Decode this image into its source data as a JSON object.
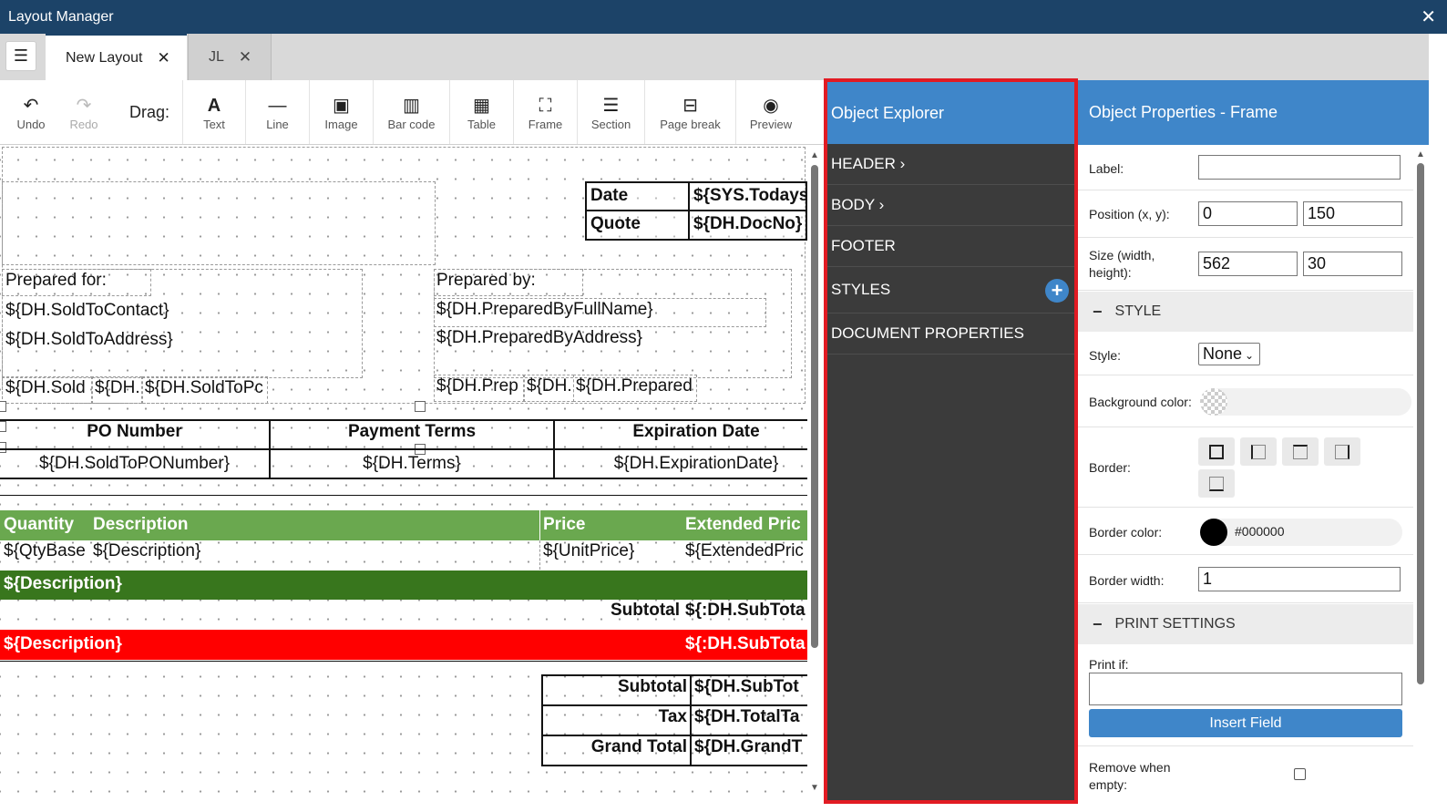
{
  "window": {
    "title": "Layout Manager",
    "close_glyph": "✕"
  },
  "tabs": [
    {
      "label": "New Layout",
      "close_glyph": "✕"
    },
    {
      "label": "JL",
      "close_glyph": "✕"
    }
  ],
  "menu_glyph": "☰",
  "toolbar": {
    "drag_label": "Drag:",
    "items": [
      {
        "label": "Undo",
        "icon": "undo-icon",
        "glyph": "↶"
      },
      {
        "label": "Redo",
        "icon": "redo-icon",
        "glyph": "↷"
      },
      {
        "label": "Text",
        "icon": "text-icon",
        "glyph": "A"
      },
      {
        "label": "Line",
        "icon": "line-icon",
        "glyph": "—"
      },
      {
        "label": "Image",
        "icon": "image-icon",
        "glyph": "▣"
      },
      {
        "label": "Bar code",
        "icon": "barcode-icon",
        "glyph": "▥"
      },
      {
        "label": "Table",
        "icon": "table-icon",
        "glyph": "▦"
      },
      {
        "label": "Frame",
        "icon": "frame-icon",
        "glyph": "⛶"
      },
      {
        "label": "Section",
        "icon": "section-icon",
        "glyph": "☰"
      },
      {
        "label": "Page break",
        "icon": "page-break-icon",
        "glyph": "⊟"
      },
      {
        "label": "Preview",
        "icon": "preview-icon",
        "glyph": "◉"
      }
    ]
  },
  "canvas": {
    "header_table": [
      {
        "label": "Date",
        "value": "${SYS.Todays"
      },
      {
        "label": "Quote",
        "value": "${DH.DocNo}"
      }
    ],
    "prepared_for": {
      "heading": "Prepared for:",
      "lines": [
        "${DH.SoldToContact}",
        "${DH.SoldToAddress}"
      ],
      "city_parts": [
        "${DH.Sold",
        "${DH.",
        "${DH.SoldToPc"
      ]
    },
    "prepared_by": {
      "heading": "Prepared by:",
      "lines": [
        "${DH.PreparedByFullName}",
        "${DH.PreparedByAddress}"
      ],
      "city_parts": [
        "${DH.Prep",
        "${DH.",
        "${DH.Prepared"
      ]
    },
    "info_table": {
      "headers": [
        "PO Number",
        "Payment Terms",
        "Expiration Date"
      ],
      "values": [
        "${DH.SoldToPONumber}",
        "${DH.Terms}",
        "${DH.ExpirationDate}"
      ]
    },
    "items_header": [
      "Quantity",
      "Description",
      "Price",
      "Extended Pric"
    ],
    "items_row": [
      "${QtyBase",
      "${Description}",
      "${UnitPrice}",
      "${ExtendedPric"
    ],
    "group_row_label": "${Description}",
    "subtotal_row": {
      "label": "Subtotal",
      "value": "${:DH.SubTota"
    },
    "red_row": {
      "label": "${Description}",
      "value": "${:DH.SubTota"
    },
    "totals": [
      {
        "label": "Subtotal",
        "value": "${DH.SubTot"
      },
      {
        "label": "Tax",
        "value": "${DH.TotalTa"
      },
      {
        "label": "Grand Total",
        "value": "${DH.GrandT"
      }
    ],
    "colors": {
      "items_header": "#6aa84f",
      "group_row": "#38761d",
      "red_row": "#ff0000"
    }
  },
  "explorer": {
    "title": "Object Explorer",
    "items": [
      {
        "label": "HEADER ›"
      },
      {
        "label": "BODY ›"
      },
      {
        "label": "FOOTER"
      },
      {
        "label": "STYLES",
        "add": "+"
      },
      {
        "label": "DOCUMENT PROPERTIES"
      }
    ]
  },
  "properties": {
    "title": "Object Properties - Frame",
    "label_field": {
      "label": "Label:",
      "value": ""
    },
    "position": {
      "label": "Position (x, y):",
      "x": "0",
      "y": "150"
    },
    "size": {
      "label_1": "Size (width,",
      "label_2": "height):",
      "width": "562",
      "height": "30"
    },
    "style_section": {
      "minus": "−",
      "title": "STYLE"
    },
    "style": {
      "label": "Style:",
      "value": "None"
    },
    "background_color": {
      "label": "Background color:"
    },
    "border": {
      "label": "Border:"
    },
    "border_color": {
      "label": "Border color:",
      "value": "#000000",
      "swatch": "#000000"
    },
    "border_width": {
      "label": "Border width:",
      "value": "1"
    },
    "print_section": {
      "minus": "−",
      "title": "PRINT SETTINGS"
    },
    "print_if": {
      "label": "Print if:",
      "value": ""
    },
    "insert_field": "Insert Field",
    "remove_when_empty": {
      "label_1": "Remove when",
      "label_2": "empty:",
      "checked": false
    }
  }
}
